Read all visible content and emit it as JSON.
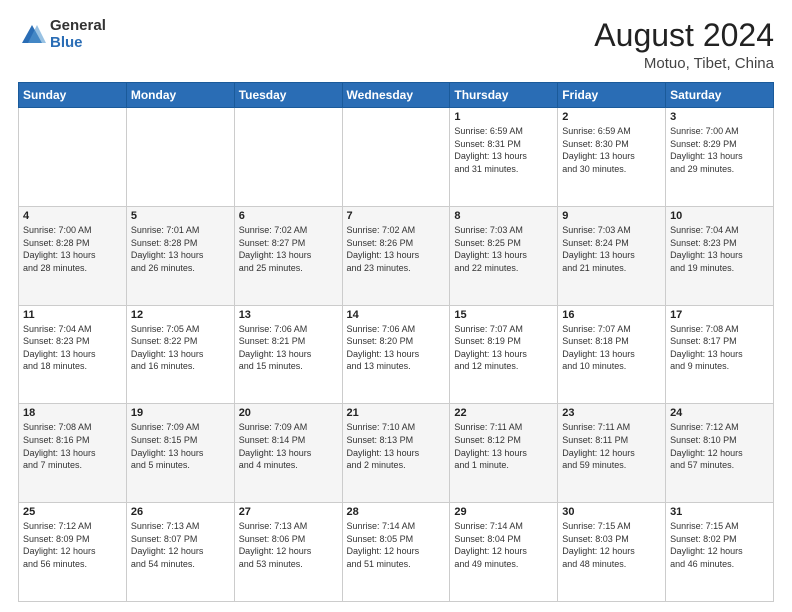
{
  "header": {
    "logo_general": "General",
    "logo_blue": "Blue",
    "month": "August 2024",
    "location": "Motuo, Tibet, China"
  },
  "days_of_week": [
    "Sunday",
    "Monday",
    "Tuesday",
    "Wednesday",
    "Thursday",
    "Friday",
    "Saturday"
  ],
  "weeks": [
    [
      {
        "day": "",
        "info": ""
      },
      {
        "day": "",
        "info": ""
      },
      {
        "day": "",
        "info": ""
      },
      {
        "day": "",
        "info": ""
      },
      {
        "day": "1",
        "info": "Sunrise: 6:59 AM\nSunset: 8:31 PM\nDaylight: 13 hours\nand 31 minutes."
      },
      {
        "day": "2",
        "info": "Sunrise: 6:59 AM\nSunset: 8:30 PM\nDaylight: 13 hours\nand 30 minutes."
      },
      {
        "day": "3",
        "info": "Sunrise: 7:00 AM\nSunset: 8:29 PM\nDaylight: 13 hours\nand 29 minutes."
      }
    ],
    [
      {
        "day": "4",
        "info": "Sunrise: 7:00 AM\nSunset: 8:28 PM\nDaylight: 13 hours\nand 28 minutes."
      },
      {
        "day": "5",
        "info": "Sunrise: 7:01 AM\nSunset: 8:28 PM\nDaylight: 13 hours\nand 26 minutes."
      },
      {
        "day": "6",
        "info": "Sunrise: 7:02 AM\nSunset: 8:27 PM\nDaylight: 13 hours\nand 25 minutes."
      },
      {
        "day": "7",
        "info": "Sunrise: 7:02 AM\nSunset: 8:26 PM\nDaylight: 13 hours\nand 23 minutes."
      },
      {
        "day": "8",
        "info": "Sunrise: 7:03 AM\nSunset: 8:25 PM\nDaylight: 13 hours\nand 22 minutes."
      },
      {
        "day": "9",
        "info": "Sunrise: 7:03 AM\nSunset: 8:24 PM\nDaylight: 13 hours\nand 21 minutes."
      },
      {
        "day": "10",
        "info": "Sunrise: 7:04 AM\nSunset: 8:23 PM\nDaylight: 13 hours\nand 19 minutes."
      }
    ],
    [
      {
        "day": "11",
        "info": "Sunrise: 7:04 AM\nSunset: 8:23 PM\nDaylight: 13 hours\nand 18 minutes."
      },
      {
        "day": "12",
        "info": "Sunrise: 7:05 AM\nSunset: 8:22 PM\nDaylight: 13 hours\nand 16 minutes."
      },
      {
        "day": "13",
        "info": "Sunrise: 7:06 AM\nSunset: 8:21 PM\nDaylight: 13 hours\nand 15 minutes."
      },
      {
        "day": "14",
        "info": "Sunrise: 7:06 AM\nSunset: 8:20 PM\nDaylight: 13 hours\nand 13 minutes."
      },
      {
        "day": "15",
        "info": "Sunrise: 7:07 AM\nSunset: 8:19 PM\nDaylight: 13 hours\nand 12 minutes."
      },
      {
        "day": "16",
        "info": "Sunrise: 7:07 AM\nSunset: 8:18 PM\nDaylight: 13 hours\nand 10 minutes."
      },
      {
        "day": "17",
        "info": "Sunrise: 7:08 AM\nSunset: 8:17 PM\nDaylight: 13 hours\nand 9 minutes."
      }
    ],
    [
      {
        "day": "18",
        "info": "Sunrise: 7:08 AM\nSunset: 8:16 PM\nDaylight: 13 hours\nand 7 minutes."
      },
      {
        "day": "19",
        "info": "Sunrise: 7:09 AM\nSunset: 8:15 PM\nDaylight: 13 hours\nand 5 minutes."
      },
      {
        "day": "20",
        "info": "Sunrise: 7:09 AM\nSunset: 8:14 PM\nDaylight: 13 hours\nand 4 minutes."
      },
      {
        "day": "21",
        "info": "Sunrise: 7:10 AM\nSunset: 8:13 PM\nDaylight: 13 hours\nand 2 minutes."
      },
      {
        "day": "22",
        "info": "Sunrise: 7:11 AM\nSunset: 8:12 PM\nDaylight: 13 hours\nand 1 minute."
      },
      {
        "day": "23",
        "info": "Sunrise: 7:11 AM\nSunset: 8:11 PM\nDaylight: 12 hours\nand 59 minutes."
      },
      {
        "day": "24",
        "info": "Sunrise: 7:12 AM\nSunset: 8:10 PM\nDaylight: 12 hours\nand 57 minutes."
      }
    ],
    [
      {
        "day": "25",
        "info": "Sunrise: 7:12 AM\nSunset: 8:09 PM\nDaylight: 12 hours\nand 56 minutes."
      },
      {
        "day": "26",
        "info": "Sunrise: 7:13 AM\nSunset: 8:07 PM\nDaylight: 12 hours\nand 54 minutes."
      },
      {
        "day": "27",
        "info": "Sunrise: 7:13 AM\nSunset: 8:06 PM\nDaylight: 12 hours\nand 53 minutes."
      },
      {
        "day": "28",
        "info": "Sunrise: 7:14 AM\nSunset: 8:05 PM\nDaylight: 12 hours\nand 51 minutes."
      },
      {
        "day": "29",
        "info": "Sunrise: 7:14 AM\nSunset: 8:04 PM\nDaylight: 12 hours\nand 49 minutes."
      },
      {
        "day": "30",
        "info": "Sunrise: 7:15 AM\nSunset: 8:03 PM\nDaylight: 12 hours\nand 48 minutes."
      },
      {
        "day": "31",
        "info": "Sunrise: 7:15 AM\nSunset: 8:02 PM\nDaylight: 12 hours\nand 46 minutes."
      }
    ]
  ],
  "colors": {
    "header_bg": "#2a6db5",
    "header_text": "#ffffff",
    "alt_row_bg": "#f5f5f5"
  }
}
